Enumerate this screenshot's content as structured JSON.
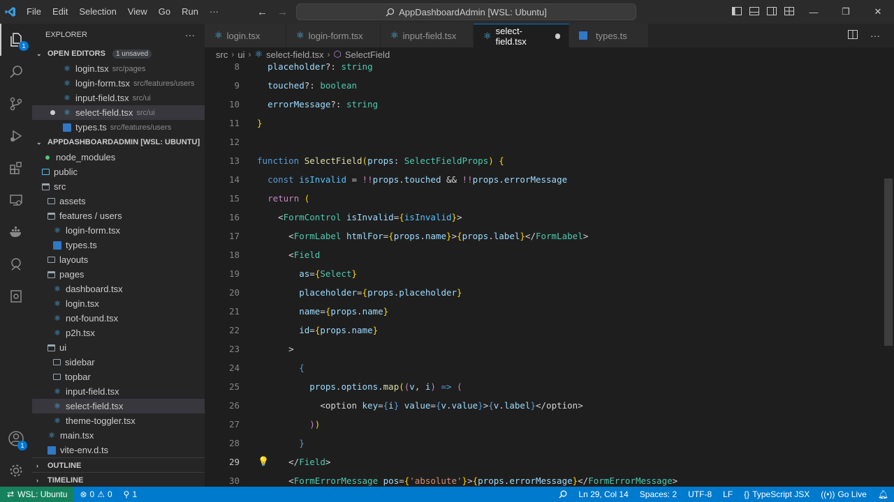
{
  "titlebar": {
    "menu": [
      "File",
      "Edit",
      "Selection",
      "View",
      "Go",
      "Run",
      "···"
    ],
    "search": "AppDashboardAdmin [WSL: Ubuntu]"
  },
  "activity": {
    "explorer_badge": "1",
    "accounts_badge": "1"
  },
  "sidebar": {
    "title": "EXPLORER",
    "open_editors_label": "OPEN EDITORS",
    "unsaved_badge": "1 unsaved",
    "open_editors": [
      {
        "name": "login.tsx",
        "path": "src/pages"
      },
      {
        "name": "login-form.tsx",
        "path": "src/features/users"
      },
      {
        "name": "input-field.tsx",
        "path": "src/ui"
      },
      {
        "name": "select-field.tsx",
        "path": "src/ui"
      },
      {
        "name": "types.ts",
        "path": "src/features/users"
      }
    ],
    "workspace_label": "APPDASHBOARDADMIN [WSL: UBUNTU]",
    "tree": {
      "node_modules": "node_modules",
      "public": "public",
      "src": "src",
      "assets": "assets",
      "features_users": "features / users",
      "login_form": "login-form.tsx",
      "types": "types.ts",
      "layouts": "layouts",
      "pages": "pages",
      "dashboard": "dashboard.tsx",
      "login": "login.tsx",
      "not_found": "not-found.tsx",
      "p2h": "p2h.tsx",
      "ui": "ui",
      "sidebar_dir": "sidebar",
      "topbar": "topbar",
      "input_field": "input-field.tsx",
      "select_field": "select-field.tsx",
      "theme_toggler": "theme-toggler.tsx",
      "main": "main.tsx",
      "vite_env": "vite-env.d.ts"
    },
    "outline_label": "OUTLINE",
    "timeline_label": "TIMELINE"
  },
  "tabs": [
    {
      "label": "login.tsx"
    },
    {
      "label": "login-form.tsx"
    },
    {
      "label": "input-field.tsx"
    },
    {
      "label": "select-field.tsx"
    },
    {
      "label": "types.ts"
    }
  ],
  "breadcrumb": [
    "src",
    "ui",
    "select-field.tsx",
    "SelectField"
  ],
  "editor": {
    "line_numbers": [
      "8",
      "9",
      "10",
      "11",
      "12",
      "13",
      "14",
      "15",
      "16",
      "17",
      "18",
      "19",
      "20",
      "21",
      "22",
      "23",
      "24",
      "25",
      "26",
      "27",
      "28",
      "29",
      "30"
    ]
  },
  "statusbar": {
    "remote": "WSL: Ubuntu",
    "errors": "0",
    "warnings": "0",
    "ports": "1",
    "position": "Ln 29, Col 14",
    "spaces": "Spaces: 2",
    "encoding": "UTF-8",
    "eol": "LF",
    "language": "TypeScript JSX",
    "golive": "Go Live"
  }
}
